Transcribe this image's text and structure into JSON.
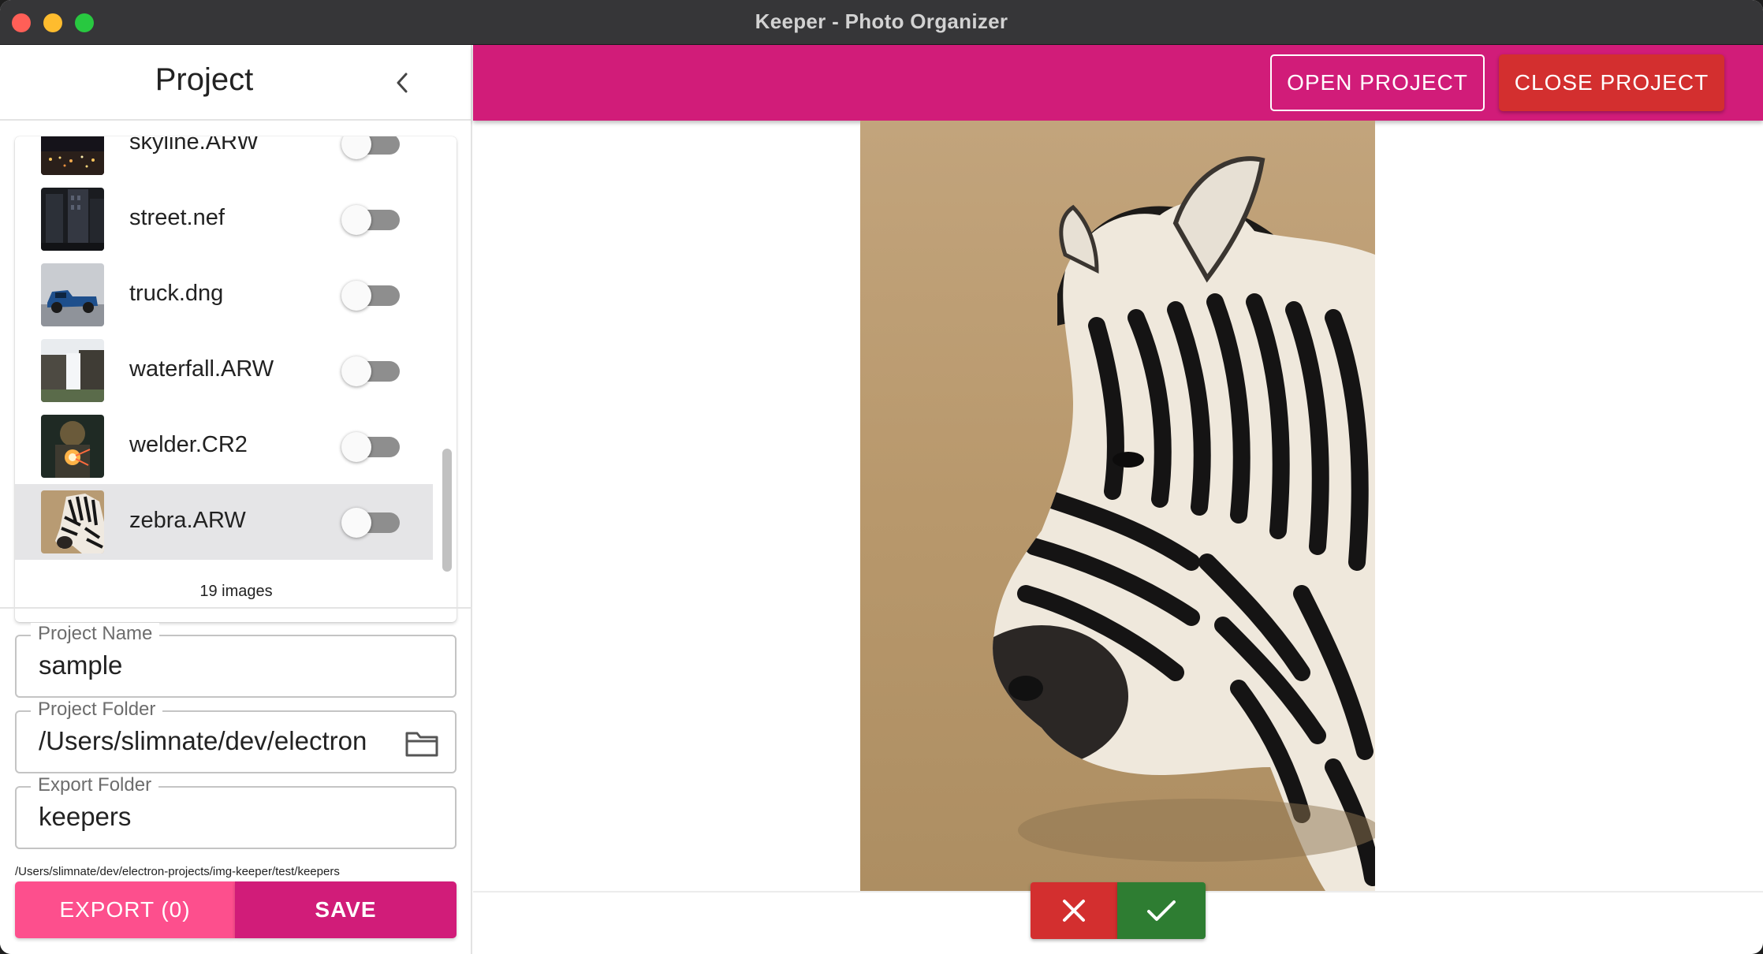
{
  "window": {
    "title": "Keeper - Photo Organizer"
  },
  "sidebar": {
    "title": "Project",
    "images": [
      {
        "name": "skyline.ARW",
        "icon": "skyline-thumbnail",
        "keep": false,
        "selected": false
      },
      {
        "name": "street.nef",
        "icon": "street-thumbnail",
        "keep": false,
        "selected": false
      },
      {
        "name": "truck.dng",
        "icon": "truck-thumbnail",
        "keep": false,
        "selected": false
      },
      {
        "name": "waterfall.ARW",
        "icon": "waterfall-thumbnail",
        "keep": false,
        "selected": false
      },
      {
        "name": "welder.CR2",
        "icon": "welder-thumbnail",
        "keep": false,
        "selected": false
      },
      {
        "name": "zebra.ARW",
        "icon": "zebra-thumbnail",
        "keep": false,
        "selected": true
      }
    ],
    "image_count": "19 images",
    "fields": {
      "project_name": {
        "label": "Project Name",
        "value": "sample"
      },
      "project_folder": {
        "label": "Project Folder",
        "value": "/Users/slimnate/dev/electron"
      },
      "export_folder": {
        "label": "Export Folder",
        "value": "keepers"
      }
    },
    "export_path": "/Users/slimnate/dev/electron-projects/img-keeper/test/keepers",
    "export_label": "EXPORT (0)",
    "save_label": "SAVE"
  },
  "appbar": {
    "open_label": "OPEN PROJECT",
    "close_label": "CLOSE PROJECT"
  },
  "colors": {
    "accent": "#d11c79",
    "export": "#fd4f8d",
    "danger": "#d32f2f",
    "success": "#2e7d32"
  }
}
